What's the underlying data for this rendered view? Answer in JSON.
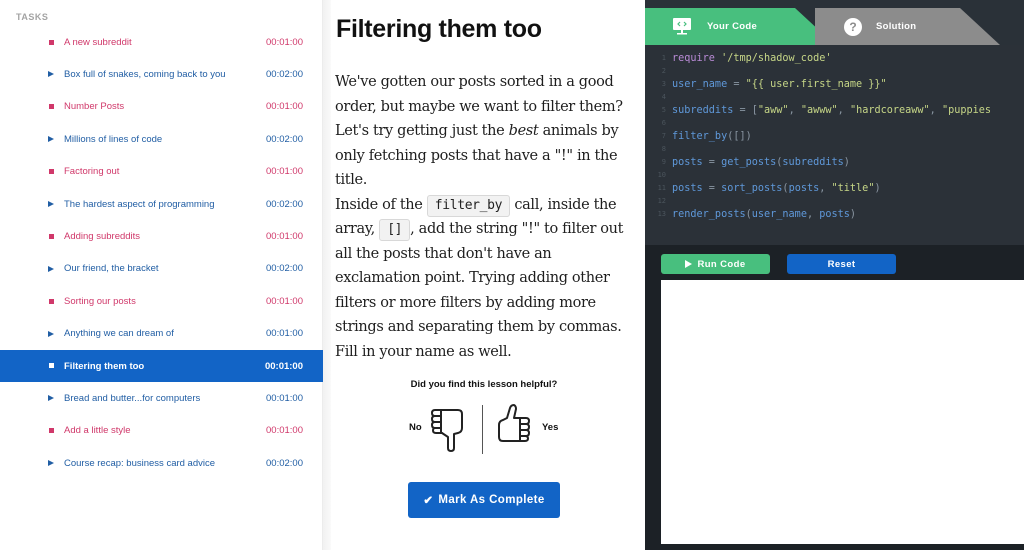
{
  "sidebar": {
    "heading": "TASKS",
    "tasks": [
      {
        "title": "A new subreddit",
        "time": "00:01:00",
        "type": "done"
      },
      {
        "title": "Box full of snakes, coming back to you",
        "time": "00:02:00",
        "type": "video"
      },
      {
        "title": "Number Posts",
        "time": "00:01:00",
        "type": "done"
      },
      {
        "title": "Millions of lines of code",
        "time": "00:02:00",
        "type": "video"
      },
      {
        "title": "Factoring out",
        "time": "00:01:00",
        "type": "done"
      },
      {
        "title": "The hardest aspect of programming",
        "time": "00:02:00",
        "type": "video"
      },
      {
        "title": "Adding subreddits",
        "time": "00:01:00",
        "type": "done"
      },
      {
        "title": "Our friend, the bracket",
        "time": "00:02:00",
        "type": "video"
      },
      {
        "title": "Sorting our posts",
        "time": "00:01:00",
        "type": "done"
      },
      {
        "title": "Anything we can dream of",
        "time": "00:01:00",
        "type": "video"
      },
      {
        "title": "Filtering them too",
        "time": "00:01:00",
        "type": "active"
      },
      {
        "title": "Bread and butter...for computers",
        "time": "00:01:00",
        "type": "video"
      },
      {
        "title": "Add a little style",
        "time": "00:01:00",
        "type": "done"
      },
      {
        "title": "Course recap: business card advice",
        "time": "00:02:00",
        "type": "video"
      }
    ]
  },
  "lesson": {
    "title": "Filtering them too",
    "p1_a": "We've gotten our posts sorted in a good order, but maybe we want to filter them? Let's try getting just the ",
    "p1_em": "best",
    "p1_b": " animals by only fetching posts that have a \"!\" in the title.",
    "p2_a": "Inside of the ",
    "p2_code1": "filter_by",
    "p2_b": " call, inside the array, ",
    "p2_code2": "[]",
    "p2_c": ", add the string \"!\" to filter out all the posts that don't have an exclamation point. Trying adding other filters or more filters by adding more strings and separating them by commas. Fill in your name as well.",
    "feedback_question": "Did you find this lesson helpful?",
    "feedback_no": "No",
    "feedback_yes": "Yes",
    "complete_check": "✔",
    "complete_label": "Mark As Complete"
  },
  "editor": {
    "tab_your_code": "Your Code",
    "tab_solution": "Solution",
    "solution_icon_glyph": "?",
    "run_label": "Run Code",
    "reset_label": "Reset",
    "lines": [
      {
        "n": "1",
        "parts": [
          [
            "kw",
            "require"
          ],
          [
            "op",
            " "
          ],
          [
            "str",
            "'/tmp/shadow_code'"
          ]
        ]
      },
      {
        "n": "2",
        "parts": []
      },
      {
        "n": "3",
        "parts": [
          [
            "var",
            "user_name"
          ],
          [
            "op",
            " = "
          ],
          [
            "str",
            "\"{{ user.first_name }}\""
          ]
        ]
      },
      {
        "n": "4",
        "parts": []
      },
      {
        "n": "5",
        "parts": [
          [
            "var",
            "subreddits"
          ],
          [
            "op",
            " = "
          ],
          [
            "op",
            "["
          ],
          [
            "str",
            "\"aww\""
          ],
          [
            "op",
            ", "
          ],
          [
            "str",
            "\"awww\""
          ],
          [
            "op",
            ", "
          ],
          [
            "str",
            "\"hardcoreaww\""
          ],
          [
            "op",
            ", "
          ],
          [
            "str",
            "\"puppies"
          ]
        ]
      },
      {
        "n": "6",
        "parts": []
      },
      {
        "n": "7",
        "parts": [
          [
            "fn",
            "filter_by"
          ],
          [
            "op",
            "([])"
          ]
        ]
      },
      {
        "n": "8",
        "parts": []
      },
      {
        "n": "9",
        "parts": [
          [
            "var",
            "posts"
          ],
          [
            "op",
            " = "
          ],
          [
            "fn",
            "get_posts"
          ],
          [
            "op",
            "("
          ],
          [
            "var",
            "subreddits"
          ],
          [
            "op",
            ")"
          ]
        ]
      },
      {
        "n": "10",
        "parts": []
      },
      {
        "n": "11",
        "parts": [
          [
            "var",
            "posts"
          ],
          [
            "op",
            " = "
          ],
          [
            "fn",
            "sort_posts"
          ],
          [
            "op",
            "("
          ],
          [
            "var",
            "posts"
          ],
          [
            "op",
            ", "
          ],
          [
            "str",
            "\"title\""
          ],
          [
            "op",
            ")"
          ]
        ]
      },
      {
        "n": "12",
        "parts": []
      },
      {
        "n": "13",
        "parts": [
          [
            "fn",
            "render_posts"
          ],
          [
            "op",
            "("
          ],
          [
            "var",
            "user_name"
          ],
          [
            "op",
            ", "
          ],
          [
            "var",
            "posts"
          ],
          [
            "op",
            ")"
          ]
        ]
      }
    ]
  },
  "colors": {
    "accent_blue": "#1264c6",
    "accent_green": "#48bf7e",
    "done_pink": "#d0386a",
    "video_blue": "#215ea4"
  }
}
